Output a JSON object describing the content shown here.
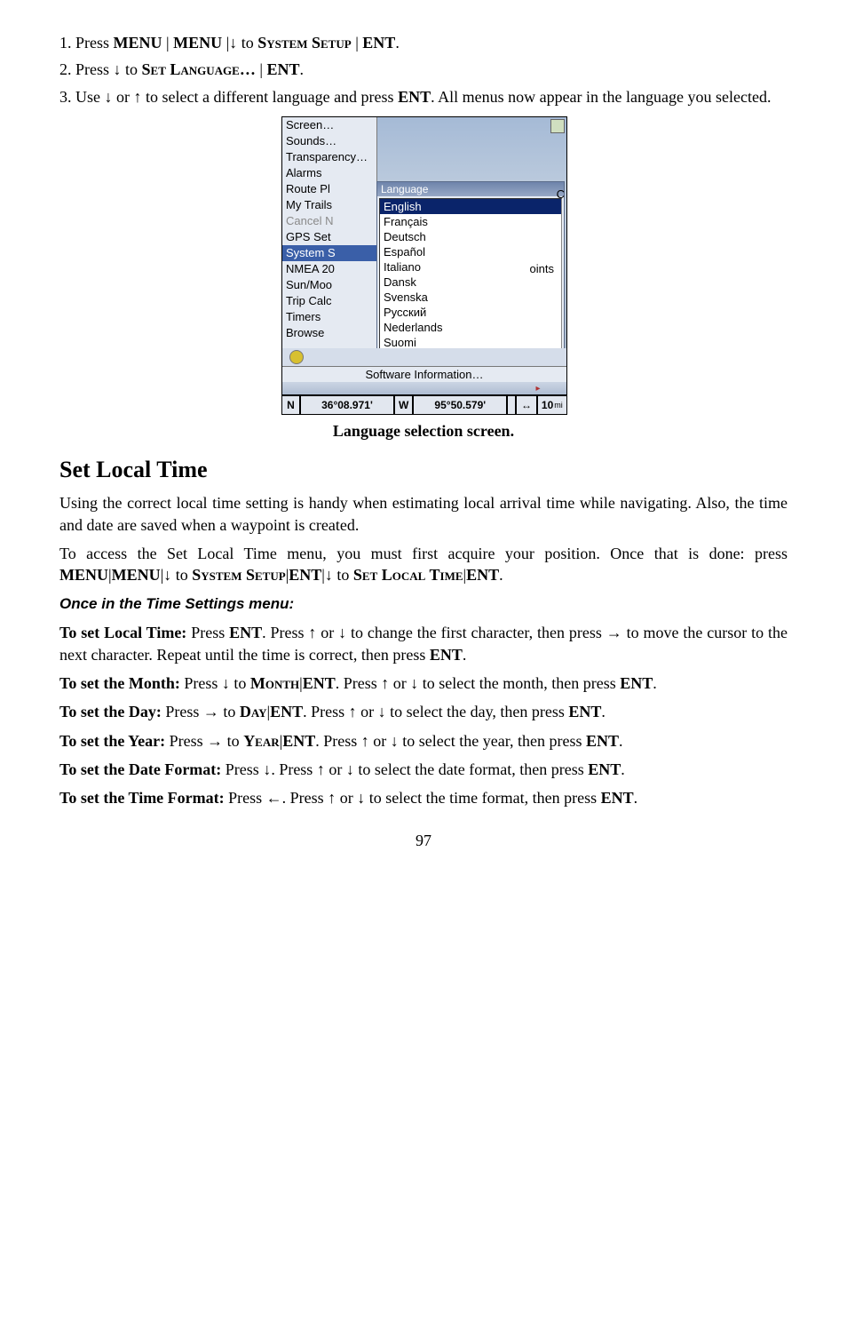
{
  "steps": {
    "s1_a": "1. Press ",
    "s1_menu": "MENU",
    "s1_pipe": "|",
    "s1_to": " to ",
    "s1_sys": "System Setup",
    "s1_ent": "ENT",
    "s2_a": "2. Press ",
    "s2_to": " to ",
    "s2_setlang": "Set Language…",
    "s3_a": "3. Use ",
    "s3_or": " or ",
    "s3_b": " to select a different language and press ",
    "s3_c": ". All menus now appear in the language you selected."
  },
  "caption1": "Language selection screen.",
  "section_title": "Set Local Time",
  "para1": "Using the correct local time setting is handy when estimating local arrival time while navigating. Also, the time and date are saved when a waypoint is created.",
  "para2_a": "To access the Set Local Time menu, you must first acquire your position. Once that is done: press ",
  "para2_sys": "System Setup",
  "para2_setlocal": "Set Local Time",
  "subhead": "Once in the Time Settings menu:",
  "paras": {
    "local_a": "To set Local Time:",
    "local_b": " Press ",
    "local_c": ". Press ",
    "local_d": " to change the first character, then press ",
    "local_e": " to move the cursor to the next character. Repeat until the time is correct, then press ",
    "month_a": "To set the Month:",
    "month_b": " Press ",
    "month_item": "Month",
    "month_c": ". Press ",
    "month_d": " to select the month, then press ",
    "day_a": "To set the Day:",
    "day_item": "Day",
    "day_d": " to select the day, then press ",
    "year_a": "To set the Year:",
    "year_item": "Year",
    "year_d": " to select the year, then press ",
    "datefmt_a": "To set the Date Format:",
    "datefmt_b": " Press ",
    "datefmt_c": ". Press ",
    "datefmt_d": " to select the date format, then press ",
    "timefmt_a": "To set the Time Format:",
    "timefmt_b": " Press  ",
    "timefmt_c": ". Press ",
    "timefmt_d": " to select the time format, then press "
  },
  "ent": "ENT",
  "or": " or ",
  "page": "97",
  "shot": {
    "menu": [
      "Screen…",
      "Sounds…",
      "Transparency…",
      "Alarms",
      "Route Pl",
      "My Trails",
      "Cancel N",
      "GPS Set",
      "System S",
      "NMEA 20",
      "Sun/Moo",
      "Trip Calc",
      "Timers",
      "Browse"
    ],
    "lang_title": "Language",
    "langs": [
      "English",
      "Français",
      "Deutsch",
      "Español",
      "Italiano",
      "Dansk",
      "Svenska",
      "Русский",
      "Nederlands",
      "Suomi"
    ],
    "points": "oints",
    "c": "C",
    "softinfo": "Software Information…",
    "status": {
      "n": "N",
      "lat": "36°08.971'",
      "w": "W",
      "lon": "95°50.579'",
      "arrows": "↔",
      "dist": "10",
      "unit": "mi"
    }
  }
}
